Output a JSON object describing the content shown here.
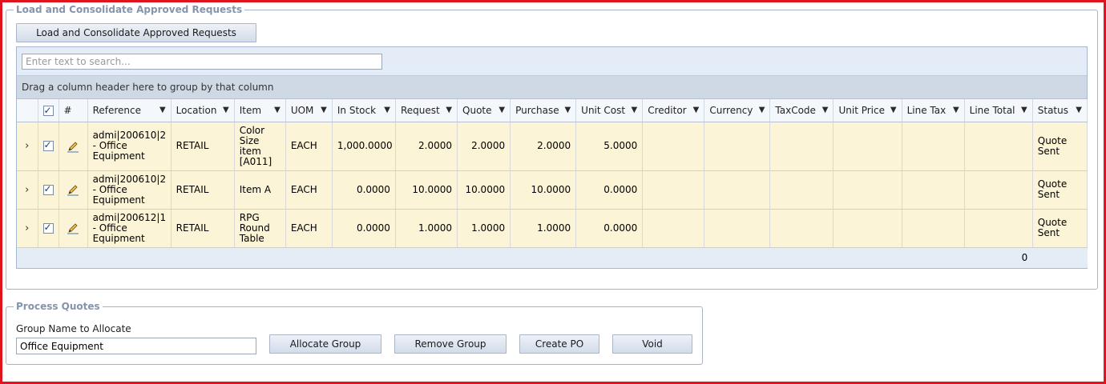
{
  "load_section": {
    "legend": "Load and Consolidate Approved Requests",
    "load_button": "Load and Consolidate Approved Requests"
  },
  "grid": {
    "search_placeholder": "Enter text to search...",
    "group_panel_text": "Drag a column header here to group by that column",
    "columns": [
      "#",
      "Reference",
      "Location",
      "Item",
      "UOM",
      "In Stock",
      "Request",
      "Quote",
      "Purchase",
      "Unit Cost",
      "Creditor",
      "Currency",
      "TaxCode",
      "Unit Price",
      "Line Tax",
      "Line Total",
      "Status"
    ],
    "rows": [
      {
        "checked": true,
        "reference": "admi|200610|2 - Office Equipment",
        "location": "RETAIL",
        "item": "Color Size item [A011]",
        "uom": "EACH",
        "in_stock": "1,000.0000",
        "request": "2.0000",
        "quote": "2.0000",
        "purchase": "2.0000",
        "unit_cost": "5.0000",
        "creditor": "",
        "currency": "",
        "taxcode": "",
        "unit_price": "",
        "line_tax": "",
        "line_total": "",
        "status": "Quote Sent"
      },
      {
        "checked": true,
        "reference": "admi|200610|2 - Office Equipment",
        "location": "RETAIL",
        "item": "Item A",
        "uom": "EACH",
        "in_stock": "0.0000",
        "request": "10.0000",
        "quote": "10.0000",
        "purchase": "10.0000",
        "unit_cost": "0.0000",
        "creditor": "",
        "currency": "",
        "taxcode": "",
        "unit_price": "",
        "line_tax": "",
        "line_total": "",
        "status": "Quote Sent"
      },
      {
        "checked": true,
        "reference": "admi|200612|1 - Office Equipment",
        "location": "RETAIL",
        "item": "RPG Round Table",
        "uom": "EACH",
        "in_stock": "0.0000",
        "request": "1.0000",
        "quote": "1.0000",
        "purchase": "1.0000",
        "unit_cost": "0.0000",
        "creditor": "",
        "currency": "",
        "taxcode": "",
        "unit_price": "",
        "line_tax": "",
        "line_total": "",
        "status": "Quote Sent"
      }
    ],
    "footer_total": "0"
  },
  "process_section": {
    "legend": "Process Quotes",
    "group_name_label": "Group Name to Allocate",
    "group_name_value": "Office Equipment",
    "buttons": {
      "allocate": "Allocate Group",
      "remove": "Remove Group",
      "create_po": "Create PO",
      "void": "Void"
    }
  },
  "icons": {
    "expand": "chevron-right-icon",
    "edit": "pencil-icon",
    "filter": "filter-icon",
    "checkbox": "checkbox-icon"
  },
  "colors": {
    "row_background": "#fbf4d6",
    "legend_text": "#8494ac",
    "frame_border": "#e0141c"
  }
}
